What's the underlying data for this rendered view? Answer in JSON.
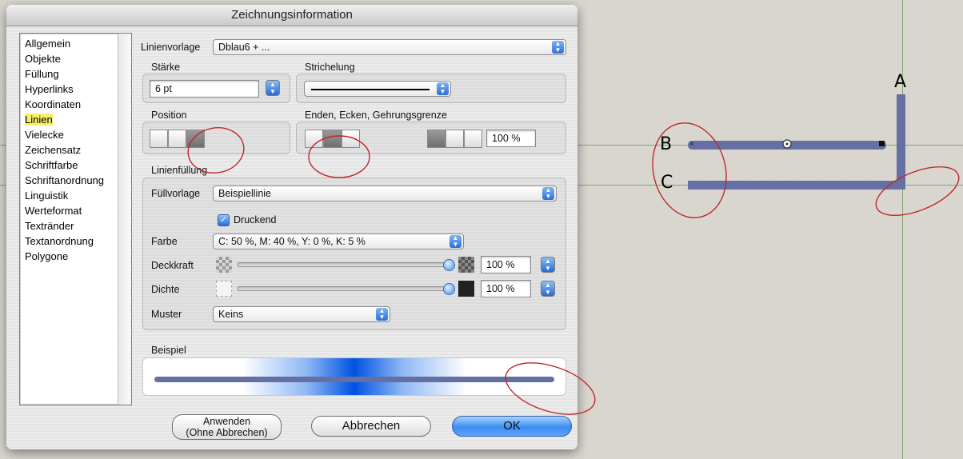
{
  "dialog": {
    "title": "Zeichnungsinformation",
    "sidebar_items": [
      "Allgemein",
      "Objekte",
      "Füllung",
      "Hyperlinks",
      "Koordinaten",
      "Linien",
      "Vielecke",
      "Zeichensatz",
      "Schriftfarbe",
      "Schriftanordnung",
      "Linguistik",
      "Werteformat",
      "Textränder",
      "Textanordnung",
      "Polygone"
    ],
    "sidebar_selected": "Linien",
    "linienvorlage": {
      "label": "Linienvorlage",
      "value": "Dblau6 + ..."
    },
    "staerke": {
      "label": "Stärke",
      "value": "6 pt"
    },
    "strichelung": {
      "label": "Strichelung"
    },
    "position": {
      "label": "Position"
    },
    "enden": {
      "label": "Enden, Ecken, Gehrungsgrenze",
      "value": "100 %"
    },
    "linienfuellung": {
      "label": "Linienfüllung",
      "fuellvorlage": {
        "label": "Füllvorlage",
        "value": "Beispiellinie"
      },
      "druckend": {
        "label": "Druckend",
        "checked": true
      },
      "farbe": {
        "label": "Farbe",
        "value": "C: 50 %, M: 40 %, Y: 0 %, K: 5 %"
      },
      "deckkraft": {
        "label": "Deckkraft",
        "value": "100 %",
        "level": 1.0
      },
      "dichte": {
        "label": "Dichte",
        "value": "100 %",
        "level": 1.0
      },
      "muster": {
        "label": "Muster",
        "value": "Keins"
      }
    },
    "beispiel": {
      "label": "Beispiel"
    },
    "buttons": {
      "apply_line1": "Anwenden",
      "apply_line2": "(Ohne Abbrechen)",
      "cancel": "Abbrechen",
      "ok": "OK"
    }
  },
  "canvas": {
    "labels": {
      "a": "A",
      "b": "B",
      "c": "C"
    },
    "line_color": "#6470a4"
  },
  "colors": {
    "annotation": "#c0282b",
    "accent": "#3c8cf2",
    "highlight": "#f6ef6a"
  }
}
